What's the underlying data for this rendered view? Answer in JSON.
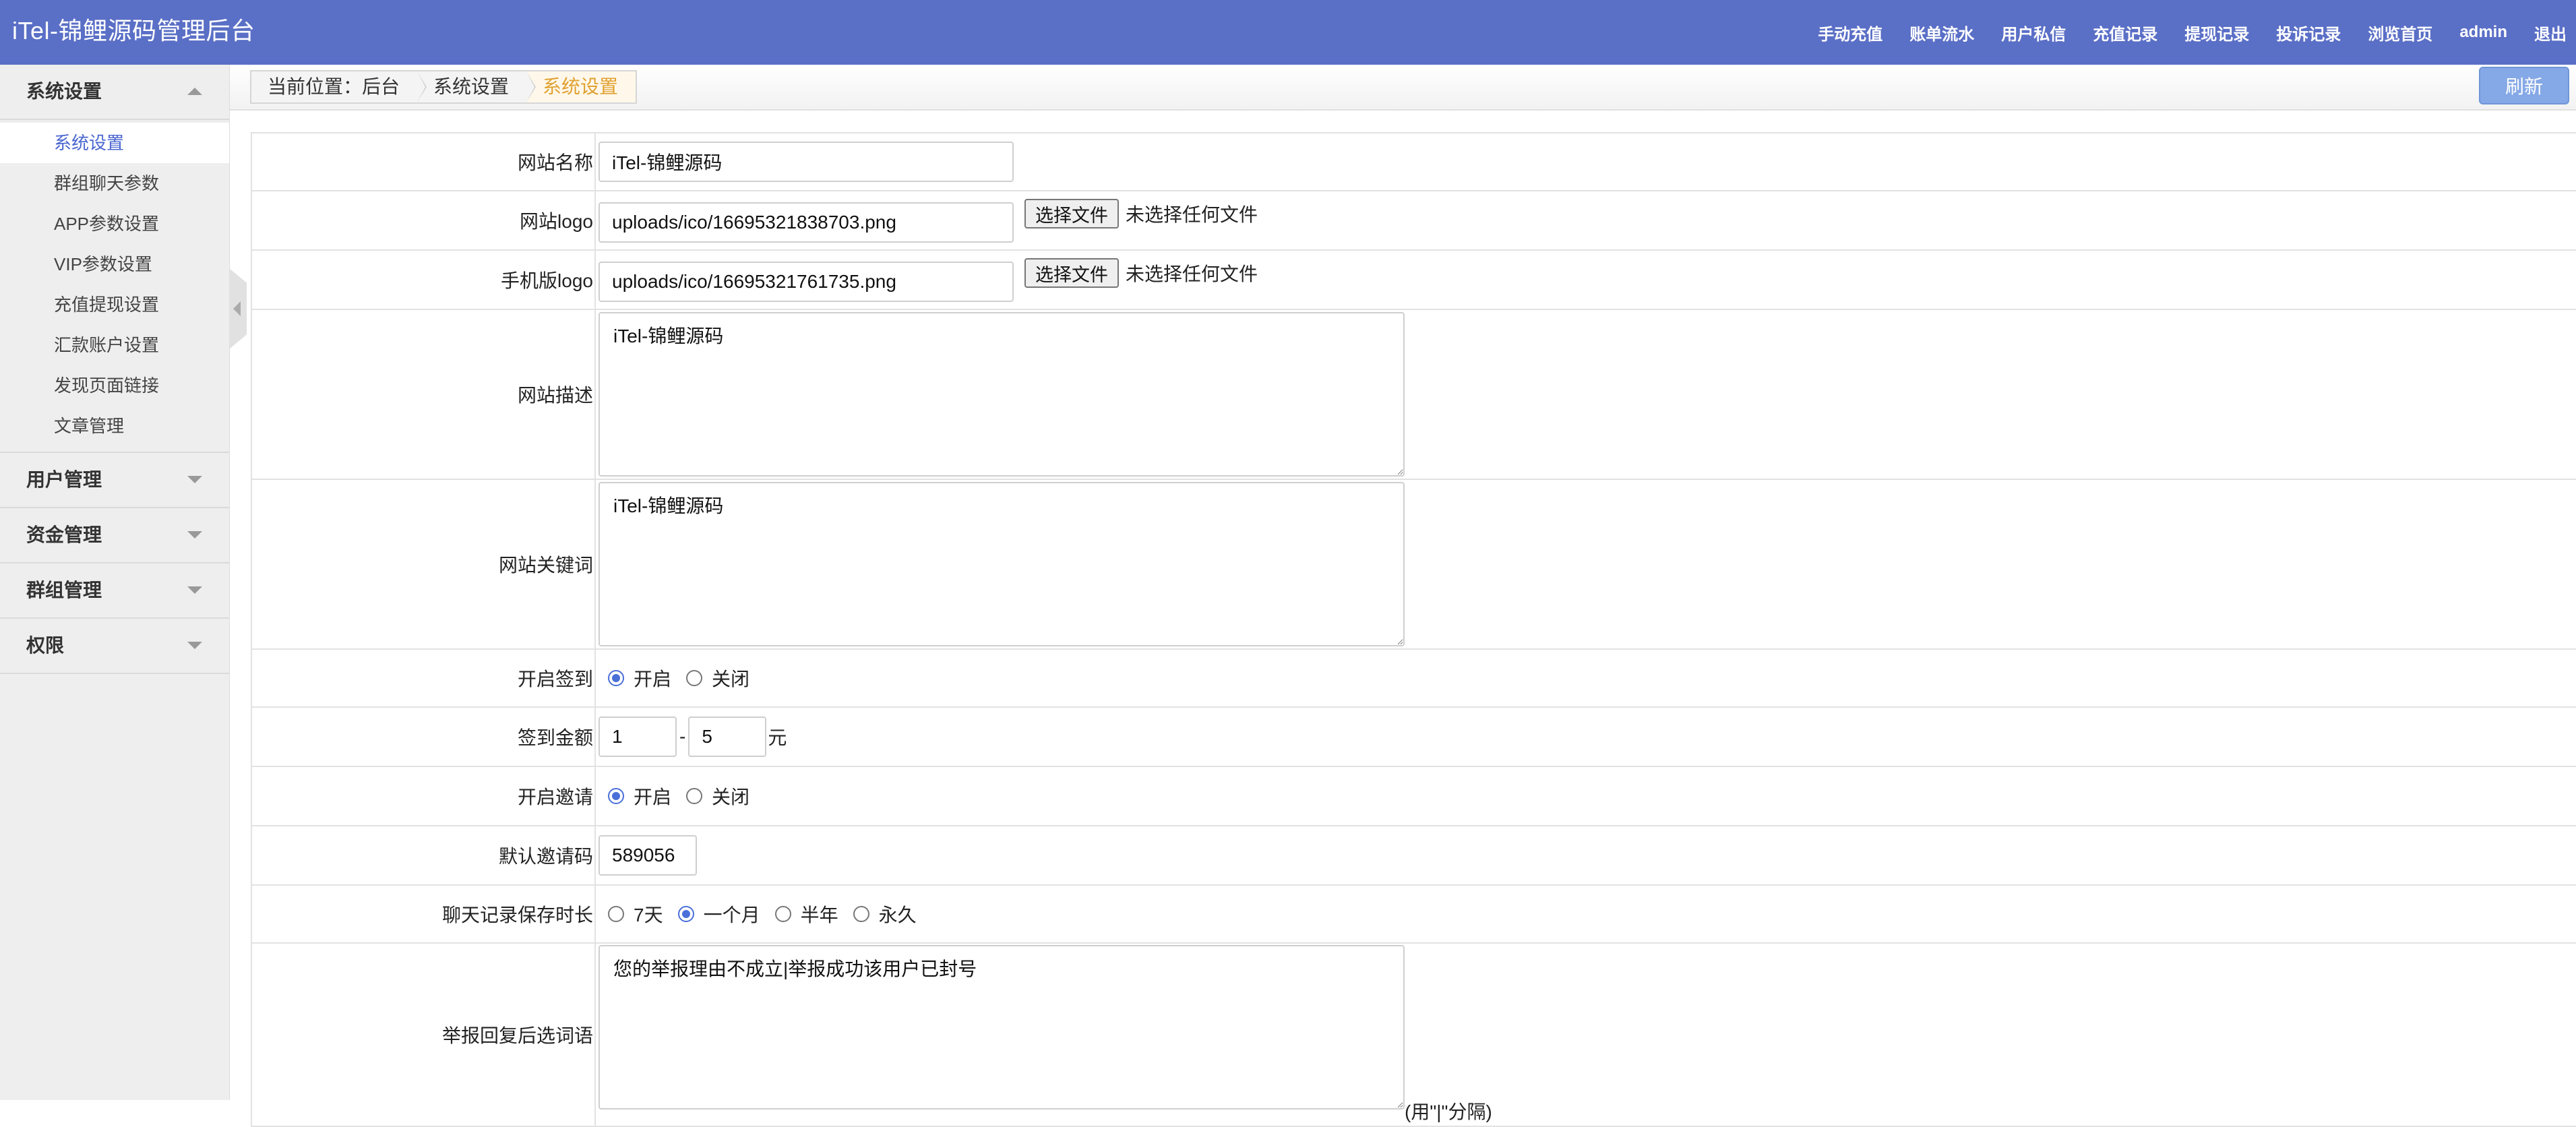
{
  "app": {
    "title": "iTel-锦鲤源码管理后台"
  },
  "topnav": [
    {
      "label": "手动充值"
    },
    {
      "label": "账单流水"
    },
    {
      "label": "用户私信"
    },
    {
      "label": "充值记录"
    },
    {
      "label": "提现记录"
    },
    {
      "label": "投诉记录"
    },
    {
      "label": "浏览首页"
    },
    {
      "label": "admin"
    },
    {
      "label": "退出"
    }
  ],
  "sidebar": {
    "groups": [
      {
        "label": "系统设置",
        "expanded": true
      },
      {
        "label": "用户管理",
        "expanded": false
      },
      {
        "label": "资金管理",
        "expanded": false
      },
      {
        "label": "群组管理",
        "expanded": false
      },
      {
        "label": "权限",
        "expanded": false
      }
    ],
    "items": [
      {
        "label": "系统设置",
        "active": true
      },
      {
        "label": "群组聊天参数"
      },
      {
        "label": "APP参数设置"
      },
      {
        "label": "VIP参数设置"
      },
      {
        "label": "充值提现设置"
      },
      {
        "label": "汇款账户设置"
      },
      {
        "label": "发现页面链接"
      },
      {
        "label": "文章管理"
      }
    ]
  },
  "breadcrumb": {
    "prefix": "当前位置：后台",
    "level1": "系统设置",
    "current": "系统设置"
  },
  "toolbar": {
    "refresh_label": "刷新"
  },
  "form": {
    "site_name": {
      "label": "网站名称",
      "value": "iTel-锦鲤源码"
    },
    "site_logo": {
      "label": "网站logo",
      "value": "uploads/ico/16695321838703.png",
      "button": "选择文件",
      "status": "未选择任何文件"
    },
    "mobile_logo": {
      "label": "手机版logo",
      "value": "uploads/ico/16695321761735.png",
      "button": "选择文件",
      "status": "未选择任何文件"
    },
    "site_desc": {
      "label": "网站描述",
      "value": "iTel-锦鲤源码"
    },
    "site_keywords": {
      "label": "网站关键词",
      "value": "iTel-锦鲤源码"
    },
    "checkin": {
      "label": "开启签到",
      "opt_on": "开启",
      "opt_off": "关闭",
      "selected": "on"
    },
    "checkin_amount": {
      "label": "签到金额",
      "min": "1",
      "max": "5",
      "dash": "-",
      "unit": "元"
    },
    "invite": {
      "label": "开启邀请",
      "opt_on": "开启",
      "opt_off": "关闭",
      "selected": "on"
    },
    "invite_code": {
      "label": "默认邀请码",
      "value": "589056"
    },
    "chat_retention": {
      "label": "聊天记录保存时长",
      "opt_7d": "7天",
      "opt_1m": "一个月",
      "opt_6m": "半年",
      "opt_forever": "永久",
      "selected": "1m"
    },
    "report_reply": {
      "label": "举报回复后选词语",
      "value": "您的举报理由不成立|举报成功该用户已封号",
      "hint": "(用\"|\"分隔)"
    }
  }
}
